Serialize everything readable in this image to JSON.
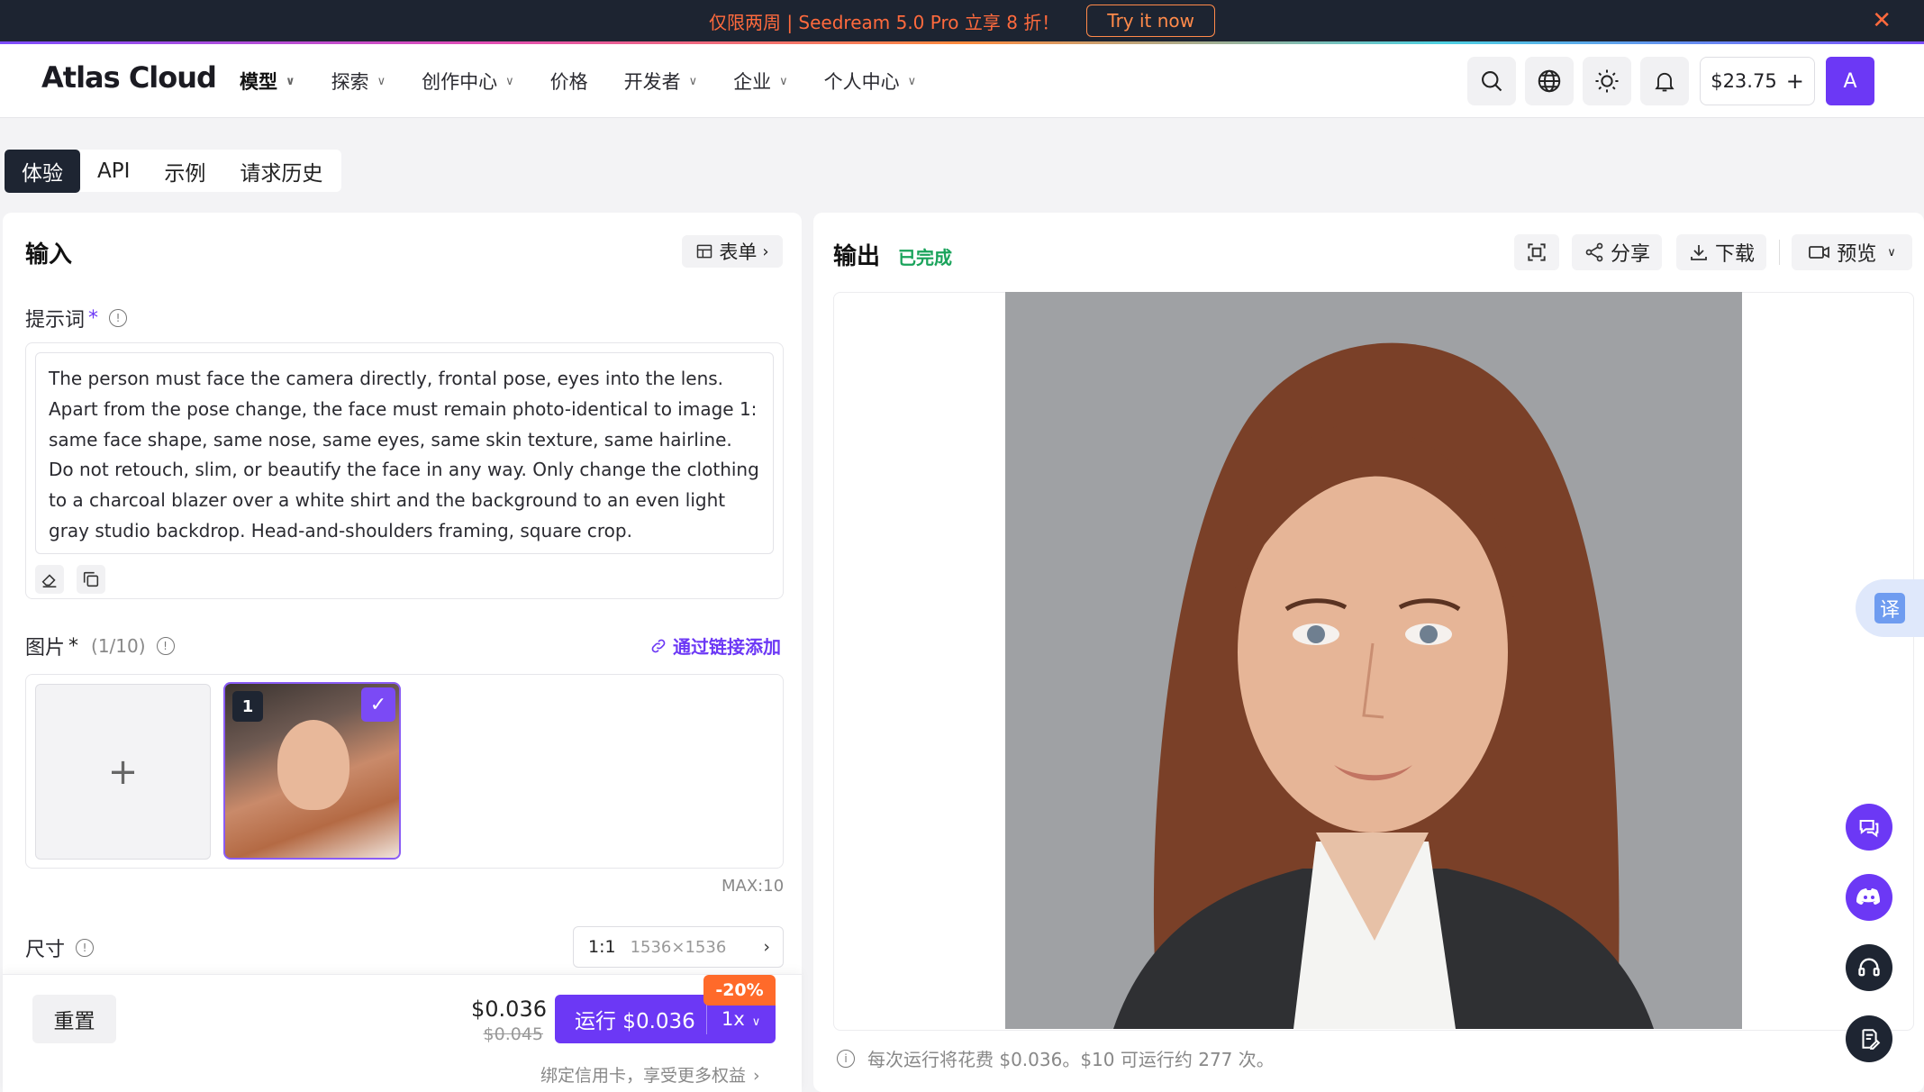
{
  "promo": {
    "text": "仅限两周 | Seedream 5.0 Pro 立享 8 折！",
    "cta": "Try it now",
    "close": "✕"
  },
  "nav": {
    "logo": "Atlas Cloud",
    "menu": [
      {
        "label": "模型",
        "chevron": true
      },
      {
        "label": "探索",
        "chevron": true
      },
      {
        "label": "创作中心",
        "chevron": true
      },
      {
        "label": "价格",
        "chevron": false
      },
      {
        "label": "开发者",
        "chevron": true
      },
      {
        "label": "企业",
        "chevron": true
      },
      {
        "label": "个人中心",
        "chevron": true
      }
    ],
    "balance": "$23.75",
    "balance_add": "+",
    "avatar": "A"
  },
  "tabs": [
    "体验",
    "API",
    "示例",
    "请求历史"
  ],
  "input": {
    "title": "输入",
    "form_btn": "表单",
    "prompt_label": "提示词",
    "required_mark": "*",
    "prompt_text": "The person must face the camera directly, frontal pose, eyes into the lens. Apart from the pose change, the face must remain photo-identical to image 1: same face shape, same nose, same eyes, same skin texture, same hairline. Do not retouch, slim, or beautify the face in any way. Only change the clothing to a charcoal blazer over a white shirt and the background to an even light gray studio backdrop. Head-and-shoulders framing, square crop.",
    "image_label": "图片",
    "image_count": "(1/10)",
    "link_add": "通过链接添加",
    "upload_plus": "+",
    "thumb_index": "1",
    "max_label": "MAX:10",
    "size_label": "尺寸",
    "size_ratio": "1:1",
    "size_dim": "1536×1536",
    "reset": "重置",
    "price": "$0.036",
    "price_old": "$0.045",
    "run_label": "运行 $0.036",
    "multiplier": "1x",
    "discount": "-20%",
    "perk": "绑定信用卡，享受更多权益"
  },
  "output": {
    "title": "输出",
    "status": "已完成",
    "share": "分享",
    "download": "下载",
    "preview": "预览",
    "note": "每次运行将花费 $0.036。$10 可运行约 277 次。"
  },
  "floating": {
    "translate": "译"
  },
  "colors": {
    "accent": "#6c38f5",
    "success": "#1aa35b",
    "promo_bg": "#1d2431",
    "promo_text": "#ff6a3d",
    "discount": "#ff6a2a"
  }
}
